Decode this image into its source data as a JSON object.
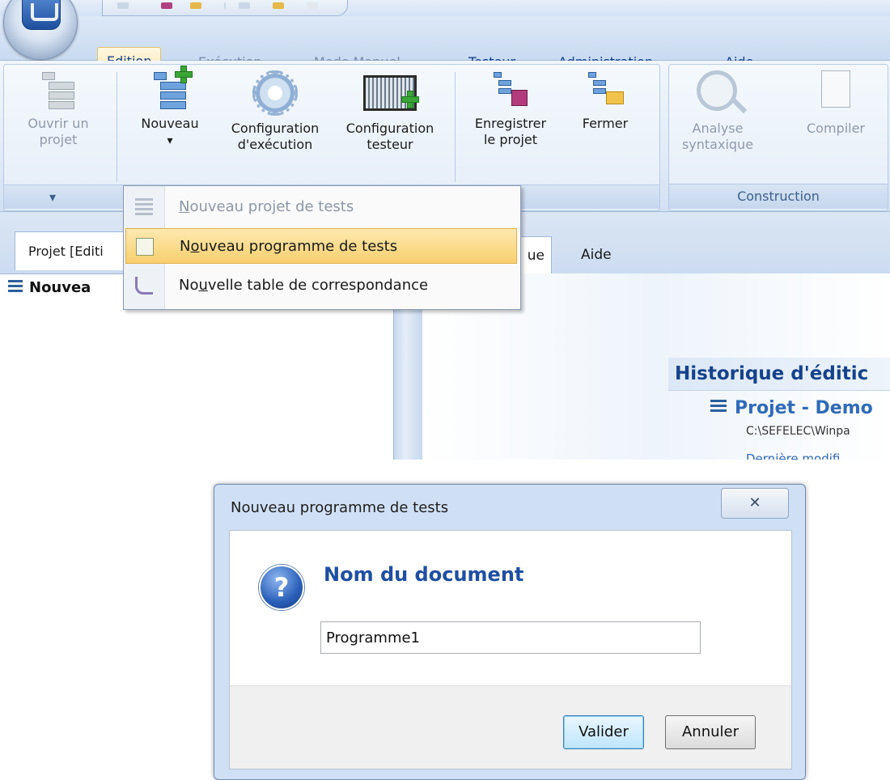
{
  "ribbon": {
    "tabs": [
      {
        "label": "Edition"
      },
      {
        "label": "Exécution"
      },
      {
        "label": "Mode Manuel"
      },
      {
        "label": "Testeur"
      },
      {
        "label": "Administration"
      },
      {
        "label": "Aide"
      }
    ],
    "buttons": {
      "open_project": {
        "line1": "Ouvrir un",
        "line2": "projet"
      },
      "new": {
        "line1": "Nouveau",
        "arrow": "▾"
      },
      "exec_config": {
        "line1": "Configuration",
        "line2": "d'exécution"
      },
      "tester_config": {
        "line1": "Configuration",
        "line2": "testeur"
      },
      "save_project": {
        "line1": "Enregistrer",
        "line2": "le projet"
      },
      "close": {
        "line1": "Fermer"
      },
      "analyse": {
        "line1": "Analyse",
        "line2": "syntaxique"
      },
      "compile": {
        "line1": "Compiler"
      }
    },
    "group_construction": "Construction",
    "collapse_arrow": "▾"
  },
  "menu": {
    "items": [
      {
        "prefix": "",
        "mnemonic": "N",
        "rest": "ouveau projet de tests",
        "enabled": false
      },
      {
        "prefix": "N",
        "mnemonic": "o",
        "rest": "uveau programme de tests",
        "enabled": true,
        "highlighted": true
      },
      {
        "prefix": "No",
        "mnemonic": "u",
        "rest": "velle table de correspondance",
        "enabled": true
      }
    ]
  },
  "left_panel": {
    "tab_label": "Projet [Editi",
    "tree_root": "Nouvea"
  },
  "right_panel": {
    "tabs": [
      {
        "label": "ue"
      },
      {
        "label": "Aide"
      }
    ],
    "history_title": "Historique d'éditic",
    "project_line": "Projet - Demo",
    "path": "C:\\SEFELEC\\Winpa",
    "cut_line": "Dernière modifi"
  },
  "dialog": {
    "title": "Nouveau programme de tests",
    "close_glyph": "✕",
    "icon_glyph": "?",
    "heading": "Nom du document",
    "input_value": "Programme1",
    "ok_label": "Valider",
    "cancel_label": "Annuler"
  },
  "colors": {
    "accent": "#15428b",
    "menu_highlight": "#f7cf6e",
    "dialog_heading": "#1f4fa3"
  }
}
